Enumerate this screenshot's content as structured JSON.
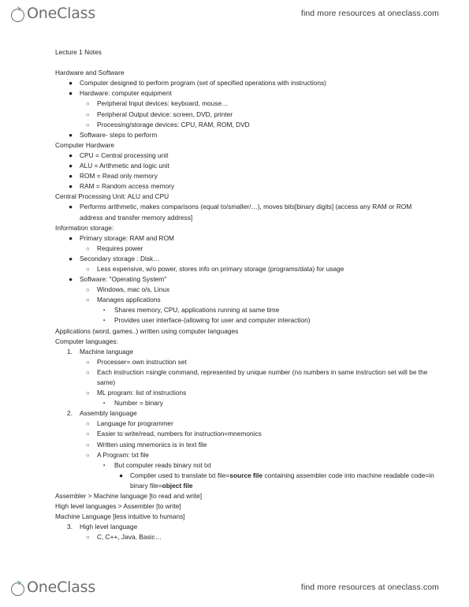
{
  "header": {
    "brand_name": "OneClass",
    "promo_text": "find more resources at oneclass.com"
  },
  "footer": {
    "brand_name": "OneClass",
    "promo_text": "find more resources at oneclass.com"
  },
  "colors": {
    "brand_gray": "#6d6e71",
    "leaf_green": "#2f8a55",
    "body_text": "#231f20"
  },
  "bullets": {
    "disc": "●",
    "circle": "○",
    "square": "▪"
  },
  "document": {
    "title": "Lecture 1 Notes",
    "lines": [
      {
        "level": 0,
        "marker": "none",
        "text": "Lecture 1 Notes"
      },
      {
        "level": "spacer",
        "marker": "none",
        "text": ""
      },
      {
        "level": 0,
        "marker": "none",
        "text": "Hardware and Software"
      },
      {
        "level": 1,
        "marker": "disc",
        "text": "Computer designed to perform program (set of specified operations with instructions)"
      },
      {
        "level": 1,
        "marker": "disc",
        "text": "Hardware: computer equipment"
      },
      {
        "level": 2,
        "marker": "circle",
        "text": "Peripheral Input devices: keyboard, mouse…"
      },
      {
        "level": 2,
        "marker": "circle",
        "text": "Peripheral Output device: screen, DVD, printer"
      },
      {
        "level": 2,
        "marker": "circle",
        "text": "Processing/storage devices: CPU, RAM, ROM, DVD"
      },
      {
        "level": 1,
        "marker": "disc",
        "text": "Software- steps to perform"
      },
      {
        "level": 0,
        "marker": "none",
        "text": "Computer Hardware"
      },
      {
        "level": 1,
        "marker": "disc",
        "text": "CPU = Central processing unit"
      },
      {
        "level": 1,
        "marker": "disc",
        "text": "ALU = Arithmetic and logic unit"
      },
      {
        "level": 1,
        "marker": "disc",
        "text": "ROM = Read only memory"
      },
      {
        "level": 1,
        "marker": "disc",
        "text": "RAM = Random access memory"
      },
      {
        "level": 0,
        "marker": "none",
        "text": "Central Processing Unit: ALU and CPU"
      },
      {
        "level": 1,
        "marker": "disc",
        "text": "Performs arithmetic, makes comparisons (equal to/smaller/…), moves bits[binary digits] (access any RAM or ROM address and transfer memory address]"
      },
      {
        "level": 0,
        "marker": "none",
        "text": "Information storage:"
      },
      {
        "level": 1,
        "marker": "disc",
        "text": "Primary storage: RAM and ROM"
      },
      {
        "level": 2,
        "marker": "circle",
        "text": "Requires power"
      },
      {
        "level": 1,
        "marker": "disc",
        "text": "Secondary storage : Disk…"
      },
      {
        "level": 2,
        "marker": "circle",
        "text": "Less expensive, w/o power, stores info on primary storage (programs/data) for usage"
      },
      {
        "level": 1,
        "marker": "disc",
        "text": "Software: \"Operating System\""
      },
      {
        "level": 2,
        "marker": "circle",
        "text": "Windows, mac o/s, Linux"
      },
      {
        "level": 2,
        "marker": "circle",
        "text": "Manages applications"
      },
      {
        "level": 3,
        "marker": "square",
        "text": "Shares memory, CPU, applications running at same time"
      },
      {
        "level": 3,
        "marker": "square",
        "text": "Provides user interface-(allowing for user and computer interaction)"
      },
      {
        "level": 0,
        "marker": "none",
        "text": "Applications (word, games..) written using computer languages"
      },
      {
        "level": 0,
        "marker": "none",
        "text": "Computer languages:"
      },
      {
        "level": 1,
        "marker": "1.",
        "text": "Machine language"
      },
      {
        "level": 2,
        "marker": "circle",
        "text": "Processer= own instruction set"
      },
      {
        "level": 2,
        "marker": "circle",
        "text": "Each instruction =single command, represented by unique number (no numbers in same instruction set will be the same)"
      },
      {
        "level": 2,
        "marker": "circle",
        "text": "ML program: list of instructions"
      },
      {
        "level": 3,
        "marker": "square",
        "text": "Number = binary"
      },
      {
        "level": 1,
        "marker": "2.",
        "text": "Assembly language"
      },
      {
        "level": 2,
        "marker": "circle",
        "text": "Language for programmer"
      },
      {
        "level": 2,
        "marker": "circle",
        "text": "Easier to write/read, numbers for instruction=mnemonics"
      },
      {
        "level": 2,
        "marker": "circle",
        "text": "Written using mnemonics is in text file"
      },
      {
        "level": 2,
        "marker": "circle",
        "text": "A Program: txt file"
      },
      {
        "level": 3,
        "marker": "square",
        "text": "But computer reads binary not txt"
      },
      {
        "level": 4,
        "marker": "disc",
        "html": "Complier used to translate txt file=<b>source file</b> containing assembler code into machine readable code=in binary file=<b>object file</b>",
        "text": "Complier used to translate txt file=source file containing assembler code into machine readable code=in binary file=object file"
      },
      {
        "level": 0,
        "marker": "none",
        "text": "Assembler >  Machine language [to read and write]"
      },
      {
        "level": 0,
        "marker": "none",
        "text": "High level languages > Assembler [to write]"
      },
      {
        "level": 0,
        "marker": "none",
        "text": "Machine Language [less intuitive to humans]"
      },
      {
        "level": 1,
        "marker": "3.",
        "text": "High level language"
      },
      {
        "level": 2,
        "marker": "circle",
        "text": "C, C++, Java, Basic…"
      }
    ]
  }
}
